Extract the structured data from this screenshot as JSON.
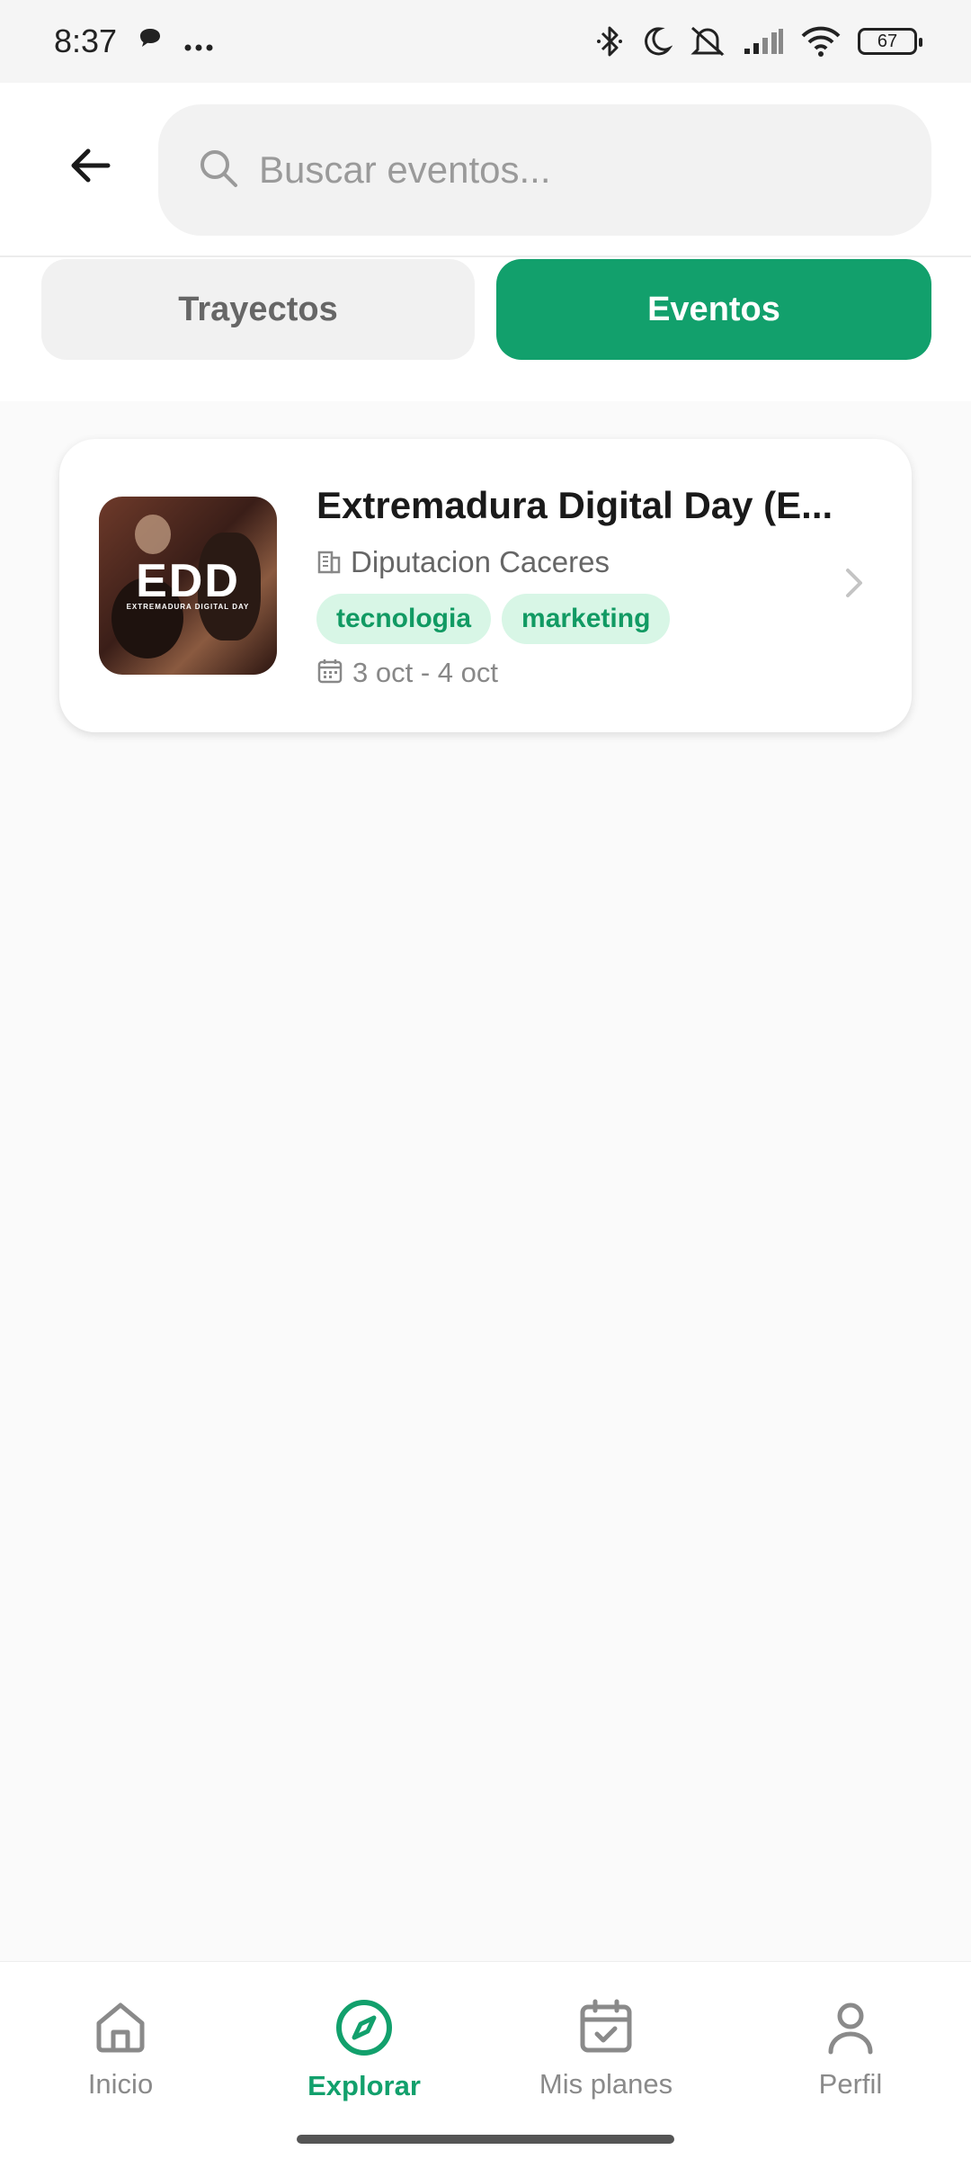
{
  "status_bar": {
    "time": "8:37",
    "notification_icons": [
      "chat-bubble-icon",
      "more-dots-icon"
    ],
    "system_icons": [
      "bluetooth-icon",
      "moon-icon",
      "mute-icon",
      "signal-icon",
      "wifi-icon"
    ],
    "battery": "67"
  },
  "header": {
    "search_placeholder": "Buscar eventos..."
  },
  "tabs": [
    {
      "label": "Trayectos",
      "active": false
    },
    {
      "label": "Eventos",
      "active": true
    }
  ],
  "events": [
    {
      "title": "Extremadura Digital Day (E...",
      "organizer": "Diputacion Caceres",
      "tags": [
        "tecnologia",
        "marketing"
      ],
      "date_range": "3 oct - 4 oct",
      "thumbnail_logo": "EDD",
      "thumbnail_subtitle": "EXTREMADURA DIGITAL DAY"
    }
  ],
  "bottom_nav": [
    {
      "label": "Inicio",
      "icon": "home-icon",
      "active": false
    },
    {
      "label": "Explorar",
      "icon": "compass-icon",
      "active": true
    },
    {
      "label": "Mis planes",
      "icon": "calendar-check-icon",
      "active": false
    },
    {
      "label": "Perfil",
      "icon": "user-icon",
      "active": false
    }
  ],
  "colors": {
    "accent": "#12a06c",
    "tag_bg": "#d8f6e6",
    "tag_text": "#119a63",
    "inactive_tab_bg": "#f1f1f1"
  }
}
